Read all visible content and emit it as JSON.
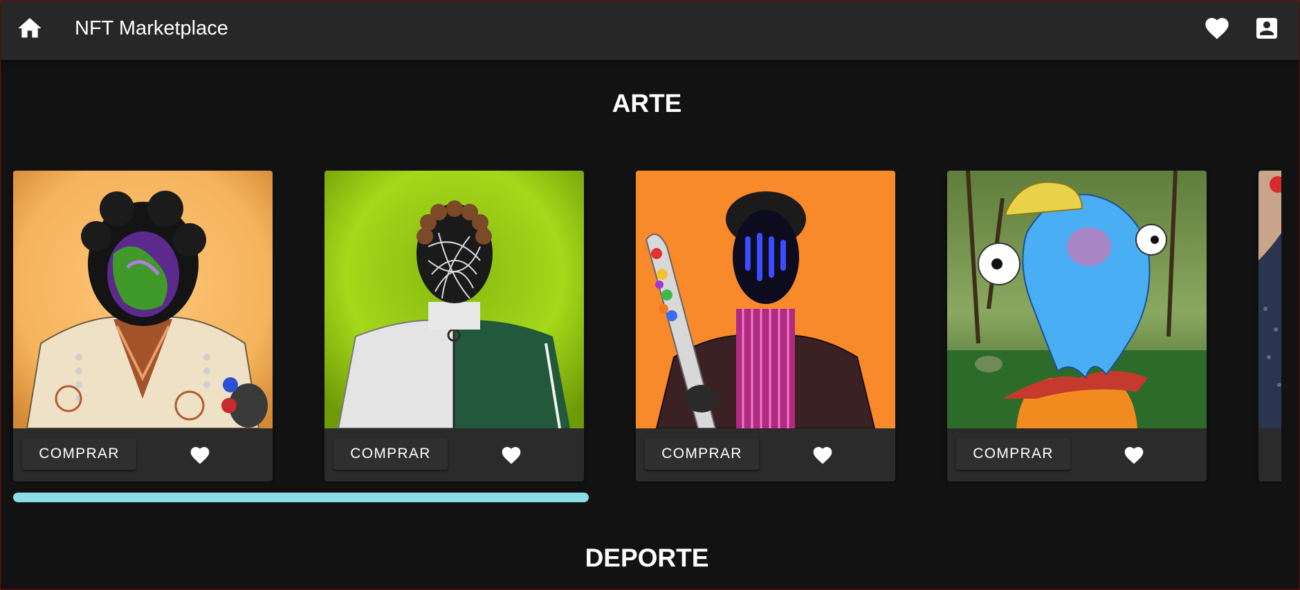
{
  "appbar": {
    "title": "NFT Marketplace",
    "home_icon": "home-icon",
    "favorites_icon": "heart-icon",
    "account_icon": "account-box-icon"
  },
  "sections": {
    "arte": {
      "title": "ARTE"
    },
    "deporte": {
      "title": "DEPORTE"
    }
  },
  "cards": [
    {
      "buy_label": "COMPRAR",
      "like_icon": "heart-icon",
      "background_color": "#f6b35b"
    },
    {
      "buy_label": "COMPRAR",
      "like_icon": "heart-icon",
      "background_color": "#a4d81a"
    },
    {
      "buy_label": "COMPRAR",
      "like_icon": "heart-icon",
      "background_color": "#f98a2c"
    },
    {
      "buy_label": "COMPRAR",
      "like_icon": "heart-icon",
      "background_color": "#4f7a33"
    }
  ],
  "carousel_scroll": {
    "visible_fraction": 0.45
  },
  "colors": {
    "background": "#121212",
    "appbar": "#272727",
    "card": "#2b2b2b",
    "scrollbar": "#8bdde8"
  }
}
